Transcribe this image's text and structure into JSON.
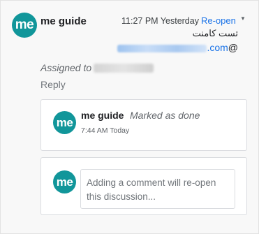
{
  "thread": {
    "avatar_text": "me",
    "author": "me guide",
    "timestamp": "11:27 PM Yesterday",
    "reopen_label": "Re-open",
    "menu_icon": "caret-down-icon",
    "comment_text": "تست کامنت",
    "email_prefix": "@",
    "email_domain": ".com",
    "assigned_label": "Assigned to",
    "reply_label": "Reply"
  },
  "event": {
    "avatar_text": "me",
    "author": "me guide",
    "status": "Marked as done",
    "time": "7:44 AM Today"
  },
  "composer": {
    "avatar_text": "me",
    "placeholder": "Adding a comment will re-open this discussion..."
  },
  "colors": {
    "accent": "#1a73e8",
    "avatar": "#11969a"
  }
}
